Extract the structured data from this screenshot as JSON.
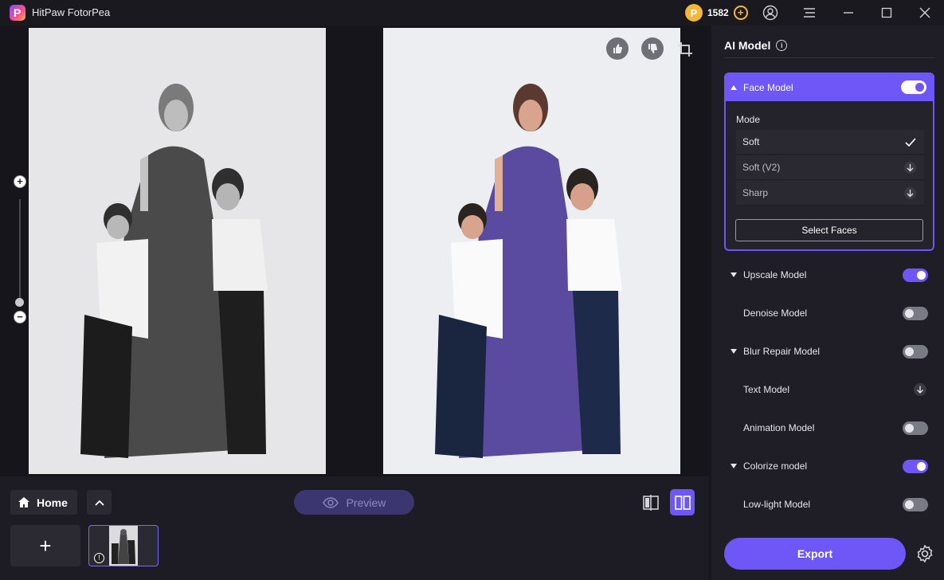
{
  "app": {
    "title": "HitPaw FotorPea",
    "coins": "1582"
  },
  "canvas": {
    "zoom_plus": "+",
    "zoom_minus": "−"
  },
  "bottom": {
    "home_label": "Home",
    "preview_label": "Preview",
    "add_label": "+"
  },
  "panel": {
    "title": "AI Model",
    "face_model": {
      "label": "Face Model",
      "enabled": true,
      "mode_label": "Mode",
      "modes": [
        {
          "label": "Soft",
          "state": "selected"
        },
        {
          "label": "Soft (V2)",
          "state": "download"
        },
        {
          "label": "Sharp",
          "state": "download"
        }
      ],
      "select_faces_label": "Select Faces"
    },
    "models": [
      {
        "label": "Upscale Model",
        "expandable": true,
        "toggle": "on"
      },
      {
        "label": "Denoise Model",
        "expandable": false,
        "toggle": "off"
      },
      {
        "label": "Blur Repair Model",
        "expandable": true,
        "toggle": "off"
      },
      {
        "label": "Text Model",
        "expandable": false,
        "toggle": "download"
      },
      {
        "label": "Animation Model",
        "expandable": false,
        "toggle": "off"
      },
      {
        "label": "Colorize model",
        "expandable": true,
        "toggle": "on"
      },
      {
        "label": "Low-light Model",
        "expandable": false,
        "toggle": "off"
      }
    ],
    "export_label": "Export"
  },
  "colors": {
    "accent": "#6e56f7",
    "panel_bg": "#1f1e26",
    "canvas_bg": "#16151b"
  }
}
